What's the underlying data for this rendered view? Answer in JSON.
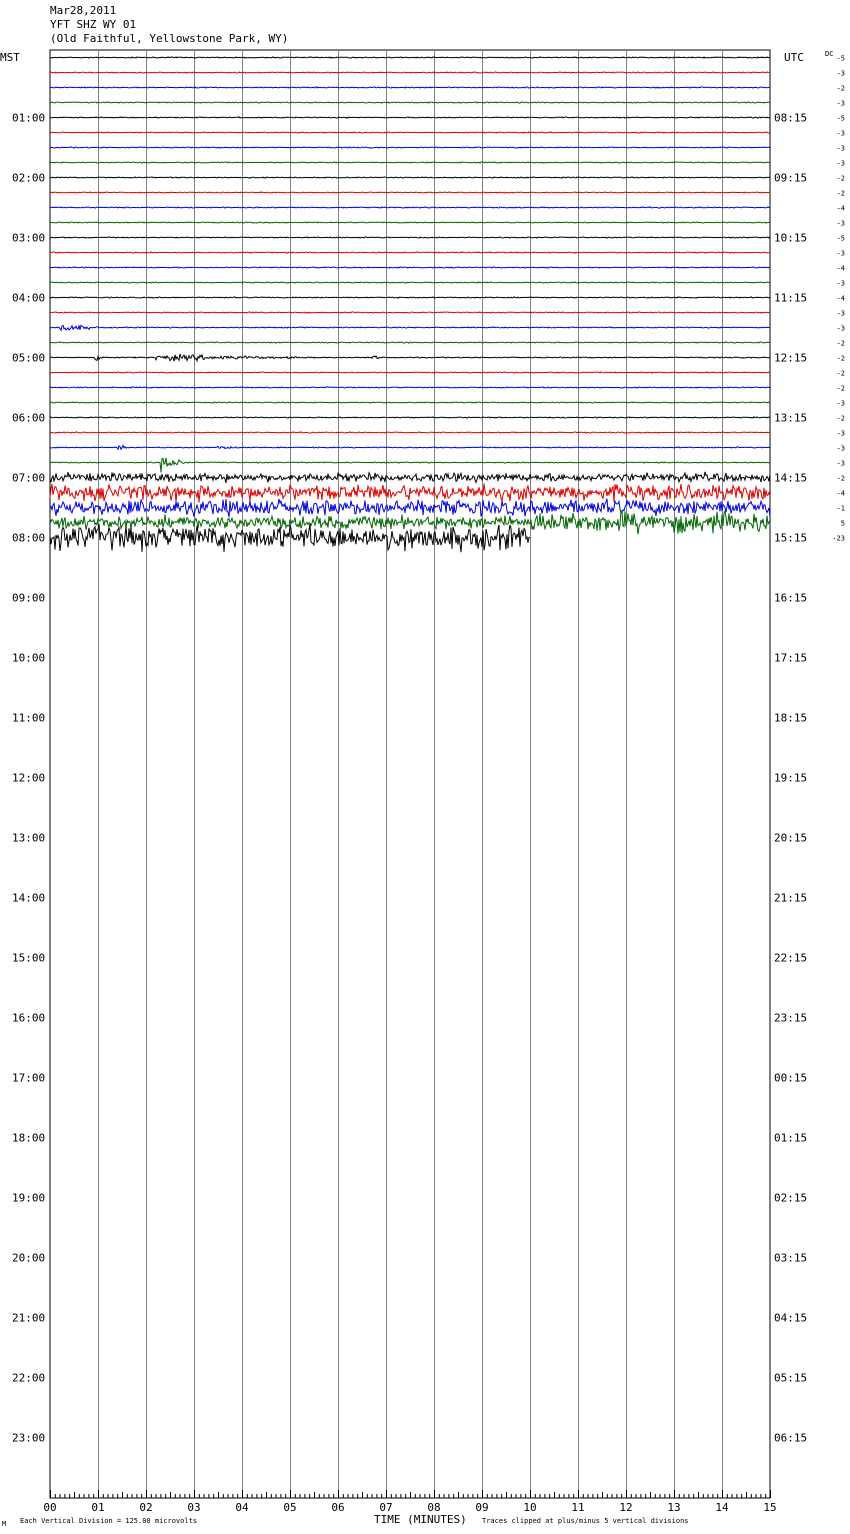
{
  "header": {
    "date": "Mar28,2011",
    "station": "YFT SHZ WY 01",
    "location": "(Old Faithful, Yellowstone Park, WY)"
  },
  "left_zone_label": "MST",
  "right_zone_label": "UTC",
  "dc_label": "DC",
  "footer": {
    "scale_note": "Each Vertical Division =  125.00 microvolts",
    "clip_note": "Traces clipped at plus/minus 5 vertical divisions",
    "corner_mark": "M"
  },
  "chart_data": {
    "type": "line",
    "title": "",
    "xlabel": "TIME (MINUTES)",
    "ylabel": "",
    "x_ticks": [
      "00",
      "01",
      "02",
      "03",
      "04",
      "05",
      "06",
      "07",
      "08",
      "09",
      "10",
      "11",
      "12",
      "13",
      "14",
      "15"
    ],
    "x_range": [
      0,
      15
    ],
    "grid": true,
    "trace_colors": [
      "#000000",
      "#dd0000",
      "#0000dd",
      "#006400"
    ],
    "left_hour_labels": [
      "01:00",
      "02:00",
      "03:00",
      "04:00",
      "05:00",
      "06:00",
      "07:00",
      "08:00",
      "09:00",
      "10:00",
      "11:00",
      "12:00",
      "13:00",
      "14:00",
      "15:00",
      "16:00",
      "17:00",
      "18:00",
      "19:00",
      "20:00",
      "21:00",
      "22:00",
      "23:00"
    ],
    "right_hour_labels": [
      "08:15",
      "09:15",
      "10:15",
      "11:15",
      "12:15",
      "13:15",
      "14:15",
      "15:15",
      "16:15",
      "17:15",
      "18:15",
      "19:15",
      "20:15",
      "21:15",
      "22:15",
      "23:15",
      "00:15",
      "01:15",
      "02:15",
      "03:15",
      "04:15",
      "05:15",
      "06:15"
    ],
    "dc_offsets": [
      "-5",
      "-3",
      "-2",
      "-3",
      "-5",
      "-3",
      "-3",
      "-3",
      "-2",
      "-2",
      "-4",
      "-3",
      "-5",
      "-3",
      "-4",
      "-3",
      "-4",
      "-3",
      "-3",
      "-2",
      "-2",
      "-2",
      "-2",
      "-3",
      "-2",
      "-3",
      "-3",
      "-3",
      "-2",
      "-4",
      "-1",
      "5",
      "-23"
    ],
    "traces_recorded": 33,
    "notable_events": [
      {
        "trace": 18,
        "start_min": 0.2,
        "end_min": 1.0,
        "peak": 1.2
      },
      {
        "trace": 20,
        "start_min": 0.9,
        "end_min": 1.2,
        "peak": 1.1
      },
      {
        "trace": 20,
        "start_min": 2.2,
        "end_min": 5.3,
        "peak": 0.8
      },
      {
        "trace": 20,
        "start_min": 6.7,
        "end_min": 7.0,
        "peak": 0.4
      },
      {
        "trace": 26,
        "start_min": 1.4,
        "end_min": 1.6,
        "peak": 1.4
      },
      {
        "trace": 26,
        "start_min": 3.5,
        "end_min": 3.9,
        "peak": 0.5
      },
      {
        "trace": 27,
        "start_min": 2.3,
        "end_min": 2.8,
        "peak": 2.5
      }
    ]
  }
}
